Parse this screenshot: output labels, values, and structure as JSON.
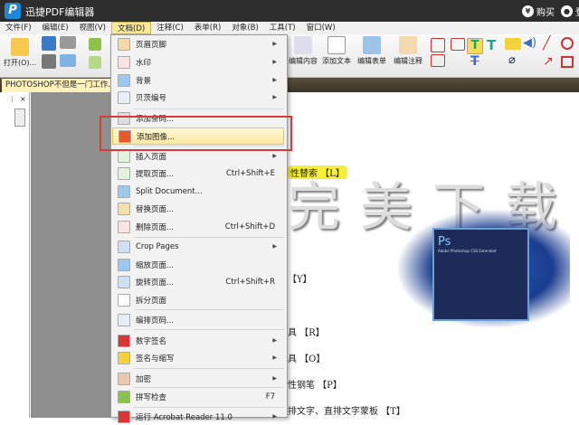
{
  "app": {
    "logo": "P",
    "title": "迅捷PDF编辑器",
    "buy": "购买",
    "login": "登",
    "buy_icon": "¥"
  },
  "menubar": [
    "文件(F)",
    "编辑(E)",
    "视图(V)",
    "文档(D)",
    "注释(C)",
    "表单(R)",
    "对象(B)",
    "工具(T)",
    "窗口(W)"
  ],
  "toolbar": {
    "open": "打开(O)...",
    "edit_content": "编辑内容",
    "add_text": "添加文本",
    "edit_form": "编辑表单",
    "edit_annotation": "编辑注释"
  },
  "tab": {
    "title": "PHOTOSHOP不但是一门工作..."
  },
  "doc_menu": [
    {
      "label": "页眉页脚",
      "arrow": true
    },
    {
      "label": "水印",
      "arrow": true
    },
    {
      "label": "背景",
      "arrow": true
    },
    {
      "label": "贝茨编号",
      "arrow": true
    },
    {
      "label": "添加条码..."
    },
    {
      "label": "添加图像..."
    },
    {
      "label": "插入页面",
      "arrow": true
    },
    {
      "label": "提取页面...",
      "shortcut": "Ctrl+Shift+E"
    },
    {
      "label": "Split Document..."
    },
    {
      "label": "替换页面..."
    },
    {
      "label": "删除页面...",
      "shortcut": "Ctrl+Shift+D"
    },
    {
      "label": "Crop Pages",
      "arrow": true
    },
    {
      "label": "缩放页面..."
    },
    {
      "label": "旋转页面...",
      "shortcut": "Ctrl+Shift+R"
    },
    {
      "label": "拆分页面"
    },
    {
      "label": "编排页码..."
    },
    {
      "label": "数字签名",
      "arrow": true
    },
    {
      "label": "签名与缩写",
      "arrow": true
    },
    {
      "label": "加密",
      "arrow": true
    },
    {
      "label": "拼写检查",
      "shortcut": "F7"
    },
    {
      "label": "运行 Acrobat Reader 11.0",
      "arrow": true
    }
  ],
  "document": {
    "watermark": "完美下载",
    "lines": [
      "性替索 【L】",
      "【Y】",
      "具 【R】",
      "具 【O】",
      "性钢笔 【P】",
      "排文字、直排文字蒙板 【T】"
    ],
    "ps_logo": "Ps",
    "ps_title": "Adobe Photoshop CS6 Extended"
  },
  "colors": {
    "accent": "#fbe99a",
    "redbox": "#d63b3b"
  }
}
